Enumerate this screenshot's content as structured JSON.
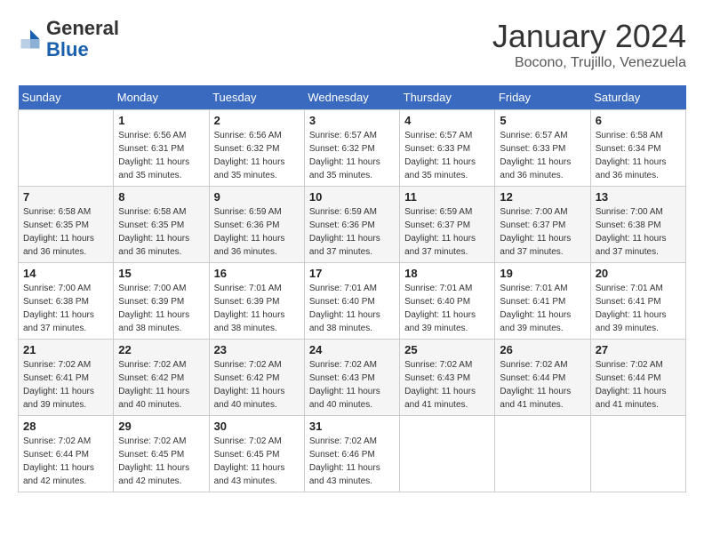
{
  "header": {
    "logo_general": "General",
    "logo_blue": "Blue",
    "title": "January 2024",
    "subtitle": "Bocono, Trujillo, Venezuela"
  },
  "calendar": {
    "days_of_week": [
      "Sunday",
      "Monday",
      "Tuesday",
      "Wednesday",
      "Thursday",
      "Friday",
      "Saturday"
    ],
    "weeks": [
      [
        {
          "day": "",
          "sunrise": "",
          "sunset": "",
          "daylight": ""
        },
        {
          "day": "1",
          "sunrise": "Sunrise: 6:56 AM",
          "sunset": "Sunset: 6:31 PM",
          "daylight": "Daylight: 11 hours and 35 minutes."
        },
        {
          "day": "2",
          "sunrise": "Sunrise: 6:56 AM",
          "sunset": "Sunset: 6:32 PM",
          "daylight": "Daylight: 11 hours and 35 minutes."
        },
        {
          "day": "3",
          "sunrise": "Sunrise: 6:57 AM",
          "sunset": "Sunset: 6:32 PM",
          "daylight": "Daylight: 11 hours and 35 minutes."
        },
        {
          "day": "4",
          "sunrise": "Sunrise: 6:57 AM",
          "sunset": "Sunset: 6:33 PM",
          "daylight": "Daylight: 11 hours and 35 minutes."
        },
        {
          "day": "5",
          "sunrise": "Sunrise: 6:57 AM",
          "sunset": "Sunset: 6:33 PM",
          "daylight": "Daylight: 11 hours and 36 minutes."
        },
        {
          "day": "6",
          "sunrise": "Sunrise: 6:58 AM",
          "sunset": "Sunset: 6:34 PM",
          "daylight": "Daylight: 11 hours and 36 minutes."
        }
      ],
      [
        {
          "day": "7",
          "sunrise": "Sunrise: 6:58 AM",
          "sunset": "Sunset: 6:35 PM",
          "daylight": "Daylight: 11 hours and 36 minutes."
        },
        {
          "day": "8",
          "sunrise": "Sunrise: 6:58 AM",
          "sunset": "Sunset: 6:35 PM",
          "daylight": "Daylight: 11 hours and 36 minutes."
        },
        {
          "day": "9",
          "sunrise": "Sunrise: 6:59 AM",
          "sunset": "Sunset: 6:36 PM",
          "daylight": "Daylight: 11 hours and 36 minutes."
        },
        {
          "day": "10",
          "sunrise": "Sunrise: 6:59 AM",
          "sunset": "Sunset: 6:36 PM",
          "daylight": "Daylight: 11 hours and 37 minutes."
        },
        {
          "day": "11",
          "sunrise": "Sunrise: 6:59 AM",
          "sunset": "Sunset: 6:37 PM",
          "daylight": "Daylight: 11 hours and 37 minutes."
        },
        {
          "day": "12",
          "sunrise": "Sunrise: 7:00 AM",
          "sunset": "Sunset: 6:37 PM",
          "daylight": "Daylight: 11 hours and 37 minutes."
        },
        {
          "day": "13",
          "sunrise": "Sunrise: 7:00 AM",
          "sunset": "Sunset: 6:38 PM",
          "daylight": "Daylight: 11 hours and 37 minutes."
        }
      ],
      [
        {
          "day": "14",
          "sunrise": "Sunrise: 7:00 AM",
          "sunset": "Sunset: 6:38 PM",
          "daylight": "Daylight: 11 hours and 37 minutes."
        },
        {
          "day": "15",
          "sunrise": "Sunrise: 7:00 AM",
          "sunset": "Sunset: 6:39 PM",
          "daylight": "Daylight: 11 hours and 38 minutes."
        },
        {
          "day": "16",
          "sunrise": "Sunrise: 7:01 AM",
          "sunset": "Sunset: 6:39 PM",
          "daylight": "Daylight: 11 hours and 38 minutes."
        },
        {
          "day": "17",
          "sunrise": "Sunrise: 7:01 AM",
          "sunset": "Sunset: 6:40 PM",
          "daylight": "Daylight: 11 hours and 38 minutes."
        },
        {
          "day": "18",
          "sunrise": "Sunrise: 7:01 AM",
          "sunset": "Sunset: 6:40 PM",
          "daylight": "Daylight: 11 hours and 39 minutes."
        },
        {
          "day": "19",
          "sunrise": "Sunrise: 7:01 AM",
          "sunset": "Sunset: 6:41 PM",
          "daylight": "Daylight: 11 hours and 39 minutes."
        },
        {
          "day": "20",
          "sunrise": "Sunrise: 7:01 AM",
          "sunset": "Sunset: 6:41 PM",
          "daylight": "Daylight: 11 hours and 39 minutes."
        }
      ],
      [
        {
          "day": "21",
          "sunrise": "Sunrise: 7:02 AM",
          "sunset": "Sunset: 6:41 PM",
          "daylight": "Daylight: 11 hours and 39 minutes."
        },
        {
          "day": "22",
          "sunrise": "Sunrise: 7:02 AM",
          "sunset": "Sunset: 6:42 PM",
          "daylight": "Daylight: 11 hours and 40 minutes."
        },
        {
          "day": "23",
          "sunrise": "Sunrise: 7:02 AM",
          "sunset": "Sunset: 6:42 PM",
          "daylight": "Daylight: 11 hours and 40 minutes."
        },
        {
          "day": "24",
          "sunrise": "Sunrise: 7:02 AM",
          "sunset": "Sunset: 6:43 PM",
          "daylight": "Daylight: 11 hours and 40 minutes."
        },
        {
          "day": "25",
          "sunrise": "Sunrise: 7:02 AM",
          "sunset": "Sunset: 6:43 PM",
          "daylight": "Daylight: 11 hours and 41 minutes."
        },
        {
          "day": "26",
          "sunrise": "Sunrise: 7:02 AM",
          "sunset": "Sunset: 6:44 PM",
          "daylight": "Daylight: 11 hours and 41 minutes."
        },
        {
          "day": "27",
          "sunrise": "Sunrise: 7:02 AM",
          "sunset": "Sunset: 6:44 PM",
          "daylight": "Daylight: 11 hours and 41 minutes."
        }
      ],
      [
        {
          "day": "28",
          "sunrise": "Sunrise: 7:02 AM",
          "sunset": "Sunset: 6:44 PM",
          "daylight": "Daylight: 11 hours and 42 minutes."
        },
        {
          "day": "29",
          "sunrise": "Sunrise: 7:02 AM",
          "sunset": "Sunset: 6:45 PM",
          "daylight": "Daylight: 11 hours and 42 minutes."
        },
        {
          "day": "30",
          "sunrise": "Sunrise: 7:02 AM",
          "sunset": "Sunset: 6:45 PM",
          "daylight": "Daylight: 11 hours and 43 minutes."
        },
        {
          "day": "31",
          "sunrise": "Sunrise: 7:02 AM",
          "sunset": "Sunset: 6:46 PM",
          "daylight": "Daylight: 11 hours and 43 minutes."
        },
        {
          "day": "",
          "sunrise": "",
          "sunset": "",
          "daylight": ""
        },
        {
          "day": "",
          "sunrise": "",
          "sunset": "",
          "daylight": ""
        },
        {
          "day": "",
          "sunrise": "",
          "sunset": "",
          "daylight": ""
        }
      ]
    ]
  }
}
